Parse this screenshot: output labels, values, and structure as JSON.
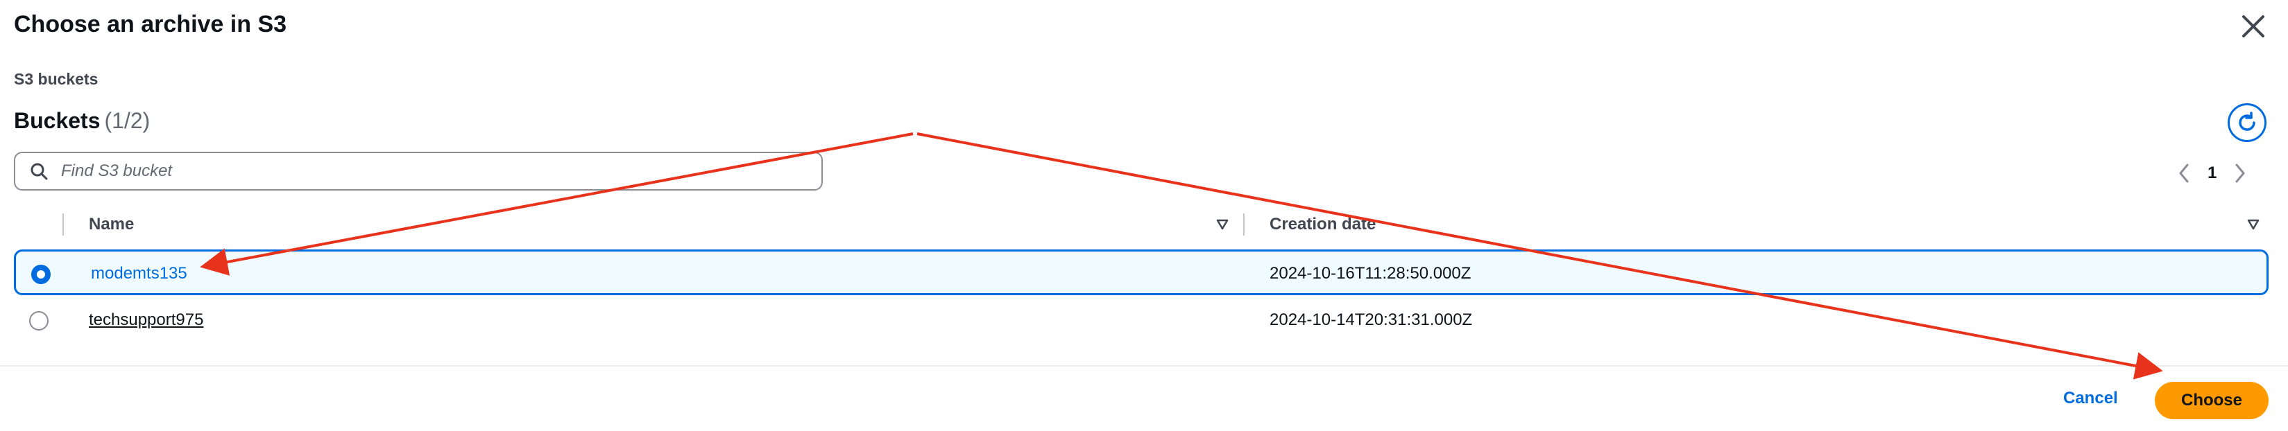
{
  "dialog": {
    "title": "Choose an archive in S3",
    "breadcrumb": "S3 buckets",
    "buckets_title": "Buckets",
    "buckets_count": "(1/2)"
  },
  "search": {
    "placeholder": "Find S3 bucket",
    "value": ""
  },
  "pagination": {
    "current_page": "1"
  },
  "table": {
    "columns": [
      "Name",
      "Creation date"
    ],
    "rows": [
      {
        "name": "modemts135",
        "creation_date": "2024-10-16T11:28:50.000Z",
        "selected": true
      },
      {
        "name": "techsupport975",
        "creation_date": "2024-10-14T20:31:31.000Z",
        "selected": false
      }
    ]
  },
  "footer": {
    "cancel_label": "Cancel",
    "choose_label": "Choose"
  },
  "icons": {
    "close": "close-icon",
    "refresh": "refresh-icon",
    "search": "search-icon",
    "prev": "chevron-left-icon",
    "next": "chevron-right-icon",
    "sort": "sort-down-icon"
  },
  "colors": {
    "accent": "#006ce0",
    "primary_button": "#ff9900",
    "annotation_arrow": "#e8331c"
  }
}
